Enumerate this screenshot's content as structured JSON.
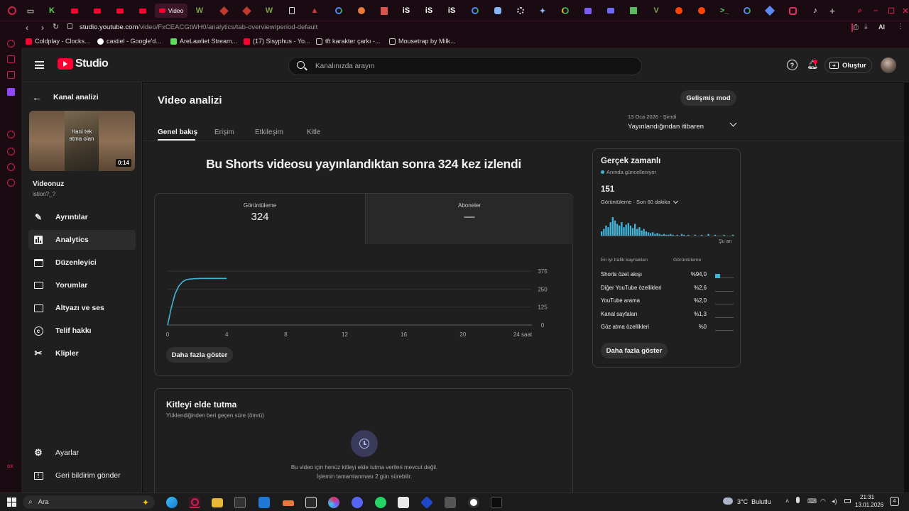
{
  "browser": {
    "active_tab_label": "Video",
    "url_prefix": "studio.youtube.com",
    "url_path": "/video/FxCEACGtWH0/analytics/tab-overview/period-default",
    "ai_label": "AI",
    "tab_letters": {
      "w": "W",
      "is": "iS"
    },
    "bookmarks": [
      "Coldplay - Clocks...",
      "castiel - Google'd...",
      "AreLawliet Stream...",
      "(17) Sisyphus - Yo...",
      "tft karakter çarkı -...",
      "Mousetrap by Milk..."
    ]
  },
  "opera_gx_label": "GX",
  "header": {
    "logo_text": "Studio",
    "search_placeholder": "Kanalınızda arayın",
    "create_label": "Oluştur"
  },
  "sidebar": {
    "back_label": "Kanal analizi",
    "thumb_caption": "Hani tek atma olan",
    "duration": "0:14",
    "video_title": "Videonuz",
    "video_sub": "istion?_?",
    "items": [
      {
        "label": "Ayrıntılar",
        "icon": "pencil-icon"
      },
      {
        "label": "Analytics",
        "icon": "analytics-icon"
      },
      {
        "label": "Düzenleyici",
        "icon": "editor-icon"
      },
      {
        "label": "Yorumlar",
        "icon": "comments-icon"
      },
      {
        "label": "Altyazı ve ses",
        "icon": "subtitles-icon"
      },
      {
        "label": "Telif hakkı",
        "icon": "copyright-icon"
      },
      {
        "label": "Klipler",
        "icon": "scissors-icon"
      }
    ],
    "settings_label": "Ayarlar",
    "feedback_label": "Geri bildirim gönder"
  },
  "main": {
    "page_title": "Video analizi",
    "advanced_mode": "Gelişmiş mod",
    "tabs": [
      "Genel bakış",
      "Erişim",
      "Etkileşim",
      "Kitle"
    ],
    "period_range": "13 Oca 2026 - Şimdi",
    "period_label": "Yayınlandığından itibaren",
    "headline": "Bu Shorts videosu yayınlandıktan sonra 324 kez izlendi",
    "metrics": [
      {
        "label": "Görüntüleme",
        "value": "324"
      },
      {
        "label": "Aboneler",
        "value": "—"
      }
    ],
    "show_more": "Daha fazla göster",
    "retention_title": "Kitleyi elde tutma",
    "retention_sub": "Yüklendiğinden beri geçen süre (ömrü)",
    "retention_msg1": "Bu video için henüz kitleyi elde tutma verileri mevcut değil.",
    "retention_msg2": "İşlemin tamamlanması 2 gün sürebilir."
  },
  "chart_data": {
    "type": "line",
    "x_ticks": [
      "0",
      "4",
      "8",
      "12",
      "16",
      "20",
      "24 saat"
    ],
    "y_ticks": [
      "375",
      "250",
      "125",
      "0"
    ],
    "xlim": [
      0,
      24
    ],
    "ylim": [
      0,
      375
    ],
    "series": [
      {
        "x": [
          0,
          0.25,
          0.5,
          0.75,
          1.0,
          1.25,
          1.5,
          1.75,
          2.0,
          2.25,
          2.5,
          3.0,
          4.0
        ],
        "y": [
          0,
          120,
          215,
          270,
          300,
          315,
          320,
          322,
          323,
          324,
          324,
          324,
          324
        ]
      }
    ],
    "color": "#41b4d9"
  },
  "realtime": {
    "title": "Gerçek zamanlı",
    "subtitle": "Anında güncelleniyor",
    "count": "151",
    "count_label": "Görüntüleme · Son 60 dakika",
    "now_label": "Şu an",
    "sources_header": "En iyi trafik kaynakları",
    "views_header": "Görüntüleme",
    "sources": [
      {
        "name": "Shorts özet akışı",
        "pct": "%94,0"
      },
      {
        "name": "Diğer YouTube özellikleri",
        "pct": "%2,6"
      },
      {
        "name": "YouTube arama",
        "pct": "%2,0"
      },
      {
        "name": "Kanal sayfaları",
        "pct": "%1,3"
      },
      {
        "name": "Göz atma özellikleri",
        "pct": "%0"
      }
    ],
    "show_more": "Daha fazla göster",
    "spark": [
      5,
      8,
      12,
      10,
      16,
      22,
      18,
      14,
      12,
      16,
      10,
      13,
      15,
      12,
      9,
      14,
      8,
      10,
      6,
      8,
      5,
      4,
      3,
      4,
      2,
      3,
      2,
      1,
      2,
      1,
      1,
      2,
      1,
      0,
      1,
      0,
      2,
      1,
      0,
      1,
      0,
      0,
      1,
      0,
      0,
      1,
      0,
      0,
      2,
      0,
      0,
      1,
      0,
      0,
      0,
      1,
      0,
      0,
      0,
      1
    ]
  },
  "taskbar": {
    "search": "Ara",
    "weather": "3°C  Bulutlu",
    "time": "21:31",
    "date": "13.01.2026",
    "notif": "4"
  }
}
